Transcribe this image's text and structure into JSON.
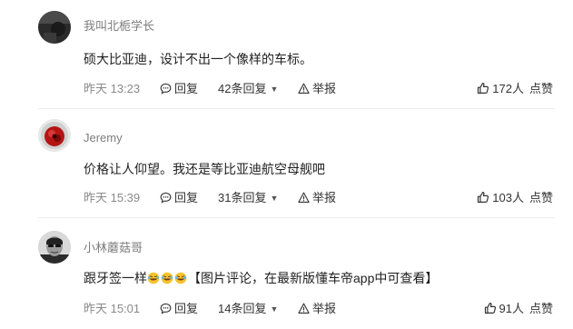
{
  "comments": [
    {
      "username": "我叫北栀学长",
      "text": "硕大比亚迪，设计不出一个像样的车标。",
      "time": "昨天 13:23",
      "reply_label": "回复",
      "replies_label": "42条回复",
      "report_label": "举报",
      "like_count": "172人",
      "like_label": "点赞"
    },
    {
      "username": "Jeremy",
      "text": "价格让人仰望。我还是等比亚迪航空母舰吧",
      "time": "昨天 15:39",
      "reply_label": "回复",
      "replies_label": "31条回复",
      "report_label": "举报",
      "like_count": "103人",
      "like_label": "点赞"
    },
    {
      "username": "小林蘑菇哥",
      "text_prefix": "跟牙签一样",
      "emoji_names": [
        "rofl-emoji",
        "rofl-emoji",
        "rofl-emoji"
      ],
      "text_suffix": "【图片评论，在最新版懂车帝app中可查看】",
      "time": "昨天 15:01",
      "reply_label": "回复",
      "replies_label": "14条回复",
      "report_label": "举报",
      "like_count": "91人",
      "like_label": "点赞"
    }
  ],
  "icons": {
    "reply": "speech-bubble-icon",
    "report": "warning-icon",
    "like": "thumbs-up-icon",
    "caret": "caret-down-icon"
  }
}
